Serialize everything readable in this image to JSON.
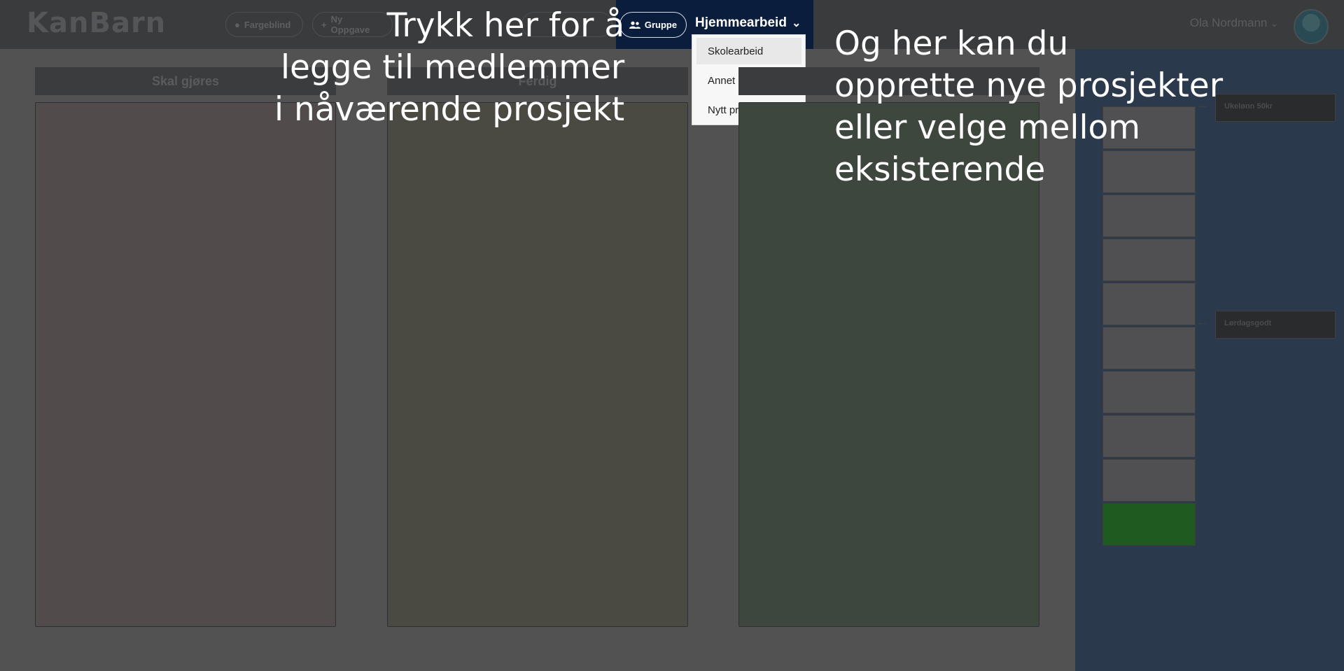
{
  "header": {
    "logo": "KanBarn",
    "colorblind_label": "Fargeblind",
    "new_task_label": "Ny Oppgave",
    "group_label": "Gruppe",
    "project_title": "Hjemmearbeid",
    "user_name": "Ola Nordmann"
  },
  "dropdown": {
    "items": [
      "Skolearbeid",
      "Annet",
      "Nytt prosjekt"
    ]
  },
  "board": {
    "columns": [
      "Skal gjøres",
      "Ferdig",
      ""
    ]
  },
  "rewards": {
    "items": [
      "Ukelønn 50kr",
      "Lørdagsgodt"
    ]
  },
  "callouts": {
    "left": "Trykk her for å\nlegge til medlemmer\ni nåværende prosjekt",
    "right": "Og her kan du\nopprette nye prosjekter\neller velge mellom\neksisterende"
  },
  "colors": {
    "accent": "#0a1d3d",
    "topbar": "#3a3b3c",
    "background": "#525252",
    "progress_done": "#1f5a20"
  },
  "progress": {
    "segments_total": 10,
    "segments_done": 1
  }
}
